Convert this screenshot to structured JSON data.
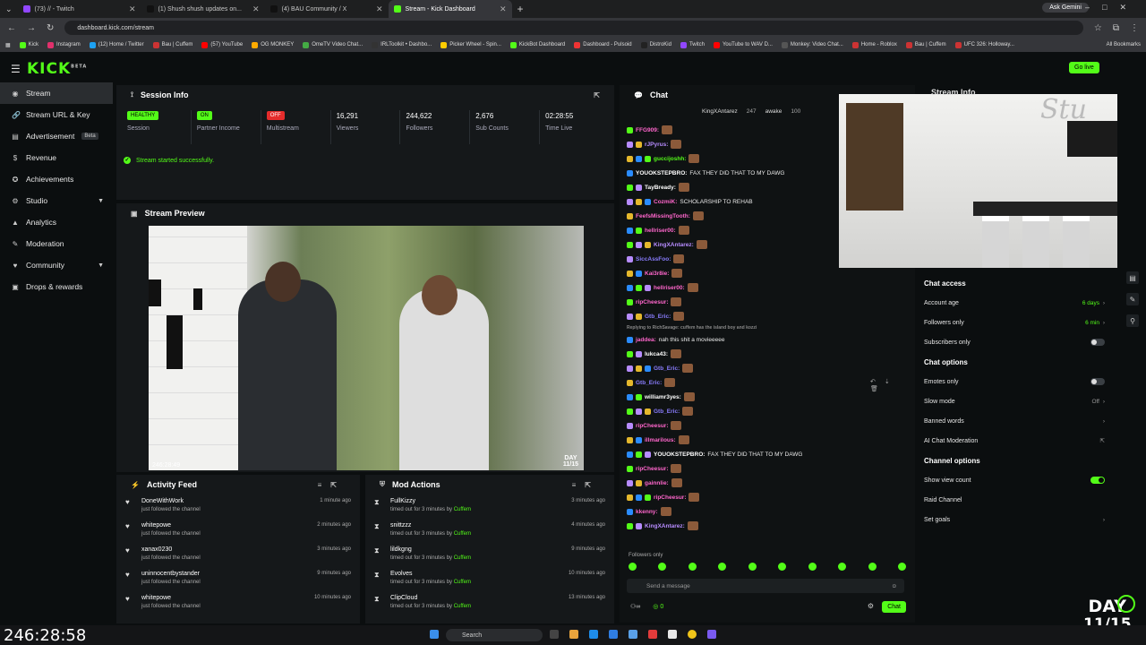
{
  "browser": {
    "tabs": [
      {
        "title": "(73) // - Twitch",
        "color": "#9147ff"
      },
      {
        "title": "(1) Shush shush updates on...",
        "color": "#111111"
      },
      {
        "title": "(4) BAU Community / X",
        "color": "#111111"
      },
      {
        "title": "Stream - Kick Dashboard",
        "color": "#53fc18"
      }
    ],
    "url": "dashboard.kick.com/stream",
    "gemini": "Ask Gemini",
    "bookmarks": [
      "Kick",
      "Instagram",
      "(12) Home / Twitter",
      "Bau | Cuffem",
      "(57) YouTube",
      "OG MONKEY",
      "OmeTV Video Chat...",
      "IRLToolkit • Dashbo...",
      "Picker Wheel - Spin...",
      "KickBot Dashboard",
      "Dashboard - Pulsoid",
      "DistroKid",
      "Twitch",
      "YouTube to WAV D...",
      "Monkey: Video Chat...",
      "Home - Roblox",
      "Bau | Cuffem",
      "UFC 326: Holloway..."
    ],
    "all_bookmarks": "All Bookmarks"
  },
  "header": {
    "logo": "KICK",
    "logo_sup": "BETA",
    "go_live": "Go live"
  },
  "sidebar": {
    "items": [
      {
        "label": "Stream",
        "icon": "◉"
      },
      {
        "label": "Stream URL & Key",
        "icon": "🔗"
      },
      {
        "label": "Advertisement",
        "icon": "▤",
        "badge": "Beta"
      },
      {
        "label": "Revenue",
        "icon": "$"
      },
      {
        "label": "Achievements",
        "icon": "✪"
      },
      {
        "label": "Studio",
        "icon": "⚙"
      },
      {
        "label": "Analytics",
        "icon": "▲"
      },
      {
        "label": "Moderation",
        "icon": "✎"
      },
      {
        "label": "Community",
        "icon": "♥"
      },
      {
        "label": "Drops & rewards",
        "icon": "▣"
      }
    ]
  },
  "session": {
    "title": "Session Info",
    "stats": [
      {
        "value": "HEALTHY",
        "label": "Session",
        "pill": "g"
      },
      {
        "value": "ON",
        "label": "Partner Income",
        "pill": "g"
      },
      {
        "value": "OFF",
        "label": "Multistream",
        "pill": "r"
      },
      {
        "value": "16,291",
        "label": "Viewers"
      },
      {
        "value": "244,622",
        "label": "Followers"
      },
      {
        "value": "2,676",
        "label": "Sub Counts"
      },
      {
        "value": "02:28:55",
        "label": "Time Live"
      }
    ],
    "message": "Stream started successfully."
  },
  "preview": {
    "title": "Stream Preview",
    "time": "246:28:49",
    "day_top": "DAY",
    "day_bottom": "11/15"
  },
  "activity": {
    "title": "Activity Feed",
    "items": [
      {
        "name": "DoneWithWork",
        "sub": "just followed the channel",
        "time": "1 minute ago"
      },
      {
        "name": "whitepowe",
        "sub": "just followed the channel",
        "time": "2 minutes ago"
      },
      {
        "name": "xanax0230",
        "sub": "just followed the channel",
        "time": "3 minutes ago"
      },
      {
        "name": "uninnocentbystander",
        "sub": "just followed the channel",
        "time": "9 minutes ago"
      },
      {
        "name": "whitepowe",
        "sub": "just followed the channel",
        "time": "10 minutes ago"
      }
    ]
  },
  "mod_actions": {
    "title": "Mod Actions",
    "items": [
      {
        "name": "FullKizzy",
        "sub": "timed out for 3 minutes by",
        "by": "Cuffem",
        "time": "3 minutes ago"
      },
      {
        "name": "snittzzz",
        "sub": "timed out for 3 minutes by",
        "by": "Cuffem",
        "time": "4 minutes ago"
      },
      {
        "name": "lildkgng",
        "sub": "timed out for 3 minutes by",
        "by": "Cuffem",
        "time": "9 minutes ago"
      },
      {
        "name": "Evolves",
        "sub": "timed out for 3 minutes by",
        "by": "Cuffem",
        "time": "10 minutes ago"
      },
      {
        "name": "ClipCloud",
        "sub": "timed out for 3 minutes by",
        "by": "Cuffem",
        "time": "13 minutes ago"
      }
    ]
  },
  "chat": {
    "title": "Chat",
    "pinned": [
      "KingXAntarez",
      "247",
      "awake",
      "100"
    ],
    "lines": [
      {
        "user": "FFG909:",
        "color": "#ff66cc",
        "text": ""
      },
      {
        "user": "rJPyrus:",
        "color": "#b78cff",
        "text": ""
      },
      {
        "user": "guccijoshh:",
        "color": "#53fc18",
        "text": ""
      },
      {
        "user": "YOUOKSTEPBRO:",
        "color": "#ffffff",
        "text": "FAX THEY DID THAT TO MY DAWG"
      },
      {
        "user": "TayBready:",
        "color": "#ffffff",
        "text": ""
      },
      {
        "user": "CozmiK:",
        "color": "#ff66cc",
        "text": "SCHOLARSHIP TO REHAB"
      },
      {
        "user": "FeefsMissingTooth:",
        "color": "#ff66cc",
        "text": ""
      },
      {
        "user": "hellriser00:",
        "color": "#ff66cc",
        "text": ""
      },
      {
        "user": "KingXAntarez:",
        "color": "#b78cff",
        "text": ""
      },
      {
        "user": "SiccAssFoo:",
        "color": "#8a7dff",
        "text": ""
      },
      {
        "user": "Kai3r8ie:",
        "color": "#ff66cc",
        "text": ""
      },
      {
        "user": "hellriser00:",
        "color": "#ff66cc",
        "text": ""
      },
      {
        "user": "ripCheesur:",
        "color": "#ff66cc",
        "text": ""
      },
      {
        "user": "Gtb_Eric:",
        "color": "#8a7dff",
        "text": ""
      },
      {
        "user": "Replying to RichSavage: cuffem has the island boy and kozzi",
        "color": "#888888",
        "text": "",
        "reply": true
      },
      {
        "user": "jaddea:",
        "color": "#ff66cc",
        "text": "nah this shit a movieeeee"
      },
      {
        "user": "lukca43:",
        "color": "#ffffff",
        "text": ""
      },
      {
        "user": "Gtb_Eric:",
        "color": "#8a7dff",
        "text": ""
      },
      {
        "user": "Gtb_Eric:",
        "color": "#8a7dff",
        "text": ""
      },
      {
        "user": "williamr3yes:",
        "color": "#ffffff",
        "text": ""
      },
      {
        "user": "Gtb_Eric:",
        "color": "#8a7dff",
        "text": ""
      },
      {
        "user": "ripCheesur:",
        "color": "#ff66cc",
        "text": ""
      },
      {
        "user": "illmarilous:",
        "color": "#ff66cc",
        "text": ""
      },
      {
        "user": "YOUOKSTEPBRO:",
        "color": "#ffffff",
        "text": "FAX THEY DID THAT TO MY DAWG"
      },
      {
        "user": "ripCheesur:",
        "color": "#ff66cc",
        "text": ""
      },
      {
        "user": "gainnlie:",
        "color": "#ff66cc",
        "text": ""
      },
      {
        "user": "ripCheesur:",
        "color": "#ff66cc",
        "text": ""
      },
      {
        "user": "kkenny:",
        "color": "#ff66cc",
        "text": ""
      },
      {
        "user": "KingXAntarez:",
        "color": "#b78cff",
        "text": ""
      }
    ],
    "followers_only": "Followers only",
    "placeholder": "Send a message",
    "count": "0",
    "chat_button": "Chat"
  },
  "info_overlay": "Stream Info",
  "settings": {
    "access_title": "Chat access",
    "access": [
      {
        "label": "Account age",
        "value": "6 days",
        "arrow": true
      },
      {
        "label": "Followers only",
        "value": "6 min",
        "arrow": true
      },
      {
        "label": "Subscribers only",
        "toggle": "off"
      }
    ],
    "options_title": "Chat options",
    "options": [
      {
        "label": "Emotes only",
        "toggle": "off"
      },
      {
        "label": "Slow mode",
        "value": "Off",
        "arrow": true
      },
      {
        "label": "Banned words",
        "arrow": true
      },
      {
        "label": "AI Chat Moderation",
        "ext": true
      }
    ],
    "channel_title": "Channel options",
    "channel": [
      {
        "label": "Show view count",
        "toggle": "on"
      },
      {
        "label": "Raid Channel"
      },
      {
        "label": "Set goals",
        "arrow": true
      }
    ]
  },
  "overlay": {
    "big_time": "246:28:58",
    "day_top": "DAY",
    "day_bottom": "11/15"
  },
  "taskbar": {
    "search": "Search"
  }
}
